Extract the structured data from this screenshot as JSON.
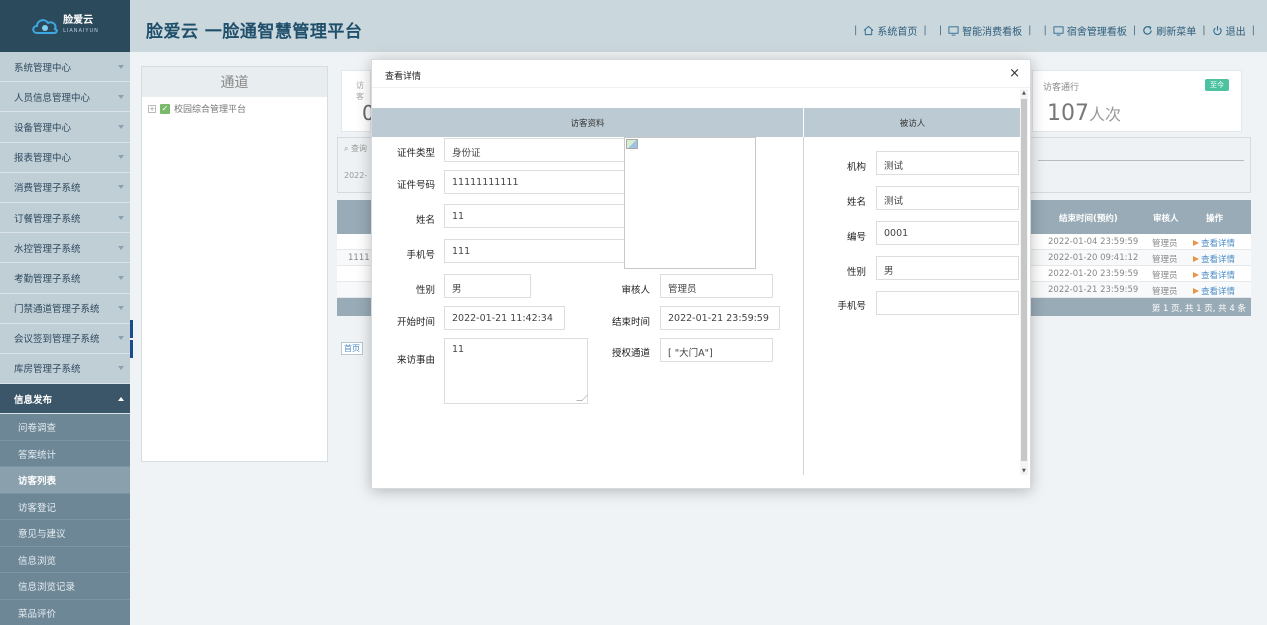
{
  "app": {
    "title": "脸爱云 一脸通智慧管理平台",
    "logo_text": "脸爱云",
    "logo_sub": "LIANAIYUN"
  },
  "topnav": [
    {
      "label": "系统首页",
      "icon": "home-icon"
    },
    {
      "label": "智能消费看板",
      "icon": "monitor-icon"
    },
    {
      "label": "宿舍管理看板",
      "icon": "monitor-icon"
    },
    {
      "label": "刷新菜单",
      "icon": "refresh-icon"
    },
    {
      "label": "退出",
      "icon": "power-icon"
    }
  ],
  "sidebar": {
    "items": [
      "系统管理中心",
      "人员信息管理中心",
      "设备管理中心",
      "报表管理中心",
      "消费管理子系统",
      "订餐管理子系统",
      "水控管理子系统",
      "考勤管理子系统",
      "门禁通道管理子系统",
      "会议签到管理子系统",
      "库房管理子系统"
    ],
    "open_item": "信息发布",
    "sub_items": [
      "问卷调查",
      "答案统计",
      "访客列表",
      "访客登记",
      "意见与建议",
      "信息浏览",
      "信息浏览记录",
      "菜品评价"
    ],
    "active_sub": "访客列表"
  },
  "tree": {
    "title": "通道",
    "node": "校园综合管理平台"
  },
  "stats": {
    "left_label": "访客",
    "left_value": "0",
    "right_label": "访客通行",
    "right_badge": "至今",
    "right_value": "107",
    "right_unit": "人次"
  },
  "search": {
    "query_label": "查询",
    "date_partial": "2022-"
  },
  "table": {
    "headers": [
      "结束时间(预约)",
      "审核人",
      "操作"
    ],
    "rows": [
      {
        "lead": "",
        "end": "2022-01-04 23:59:59",
        "auditor": "管理员",
        "op": "查看详情"
      },
      {
        "lead": "1111",
        "end": "2022-01-20 09:41:12",
        "auditor": "管理员",
        "op": "查看详情"
      },
      {
        "lead": "",
        "end": "2022-01-20 23:59:59",
        "auditor": "管理员",
        "op": "查看详情"
      },
      {
        "lead": "",
        "end": "2022-01-21 23:59:59",
        "auditor": "管理员",
        "op": "查看详情"
      }
    ],
    "footer": "第 1 页, 共 1 页, 共 4 条",
    "pager_first": "首页"
  },
  "modal": {
    "title": "查看详情",
    "close": "×",
    "visitor_section": "访客资料",
    "host_section": "被访人",
    "visitor": {
      "id_type_label": "证件类型",
      "id_type": "身份证",
      "id_no_label": "证件号码",
      "id_no": "11111111111",
      "name_label": "姓名",
      "name": "11",
      "phone_label": "手机号",
      "phone": "111",
      "gender_label": "性别",
      "gender": "男",
      "auditor_label": "审核人",
      "auditor": "管理员",
      "start_label": "开始时间",
      "start": "2022-01-21 11:42:34",
      "end_label": "结束时间",
      "end": "2022-01-21 23:59:59",
      "reason_label": "来访事由",
      "reason": "11",
      "channel_label": "授权通道",
      "channel": "[ \"大门A\"]"
    },
    "host": {
      "org_label": "机构",
      "org": "测试",
      "name_label": "姓名",
      "name": "测试",
      "no_label": "编号",
      "no": "0001",
      "gender_label": "性别",
      "gender": "男",
      "phone_label": "手机号",
      "phone": ""
    }
  },
  "colors": {
    "header_bg": "#cad8de",
    "logo_bg": "#2b4a5c",
    "sidebar_bg": "#c0ced6",
    "sidebar_open": "#3a5668",
    "sub_bg": "#6e8796",
    "section_head": "#bccbd3",
    "table_head": "#98abb6",
    "badge": "#4cc2a1"
  }
}
